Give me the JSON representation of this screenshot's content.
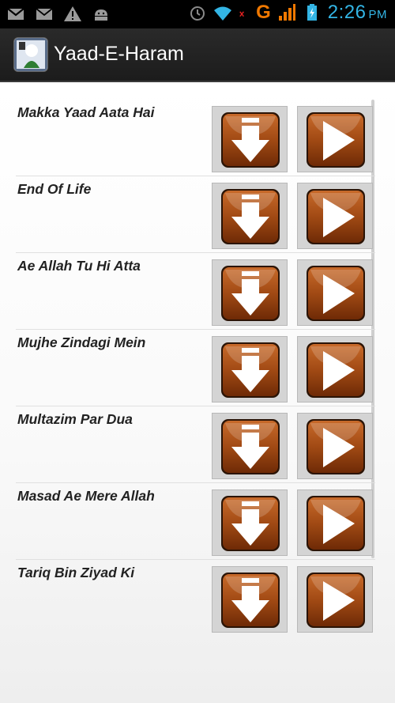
{
  "status_bar": {
    "time": "2:26",
    "ampm": "PM",
    "network_letter": "G",
    "icons": [
      "gmail-icon",
      "email-icon",
      "warning-icon",
      "android-icon",
      "alarm-icon",
      "wifi-icon",
      "signal-icon",
      "battery-icon"
    ]
  },
  "action_bar": {
    "title": "Yaad-E-Haram"
  },
  "list": {
    "items": [
      {
        "title": "Makka Yaad Aata Hai"
      },
      {
        "title": "End Of Life"
      },
      {
        "title": "Ae Allah Tu Hi Atta"
      },
      {
        "title": "Mujhe Zindagi Mein"
      },
      {
        "title": "Multazim Par Dua"
      },
      {
        "title": "Masad Ae Mere Allah"
      },
      {
        "title": "Tariq Bin Ziyad Ki"
      }
    ]
  },
  "colors": {
    "button_brown": "#8b3d10",
    "button_highlight": "#c86a2a",
    "time_blue": "#33b5e5",
    "network_orange": "#f07800"
  }
}
